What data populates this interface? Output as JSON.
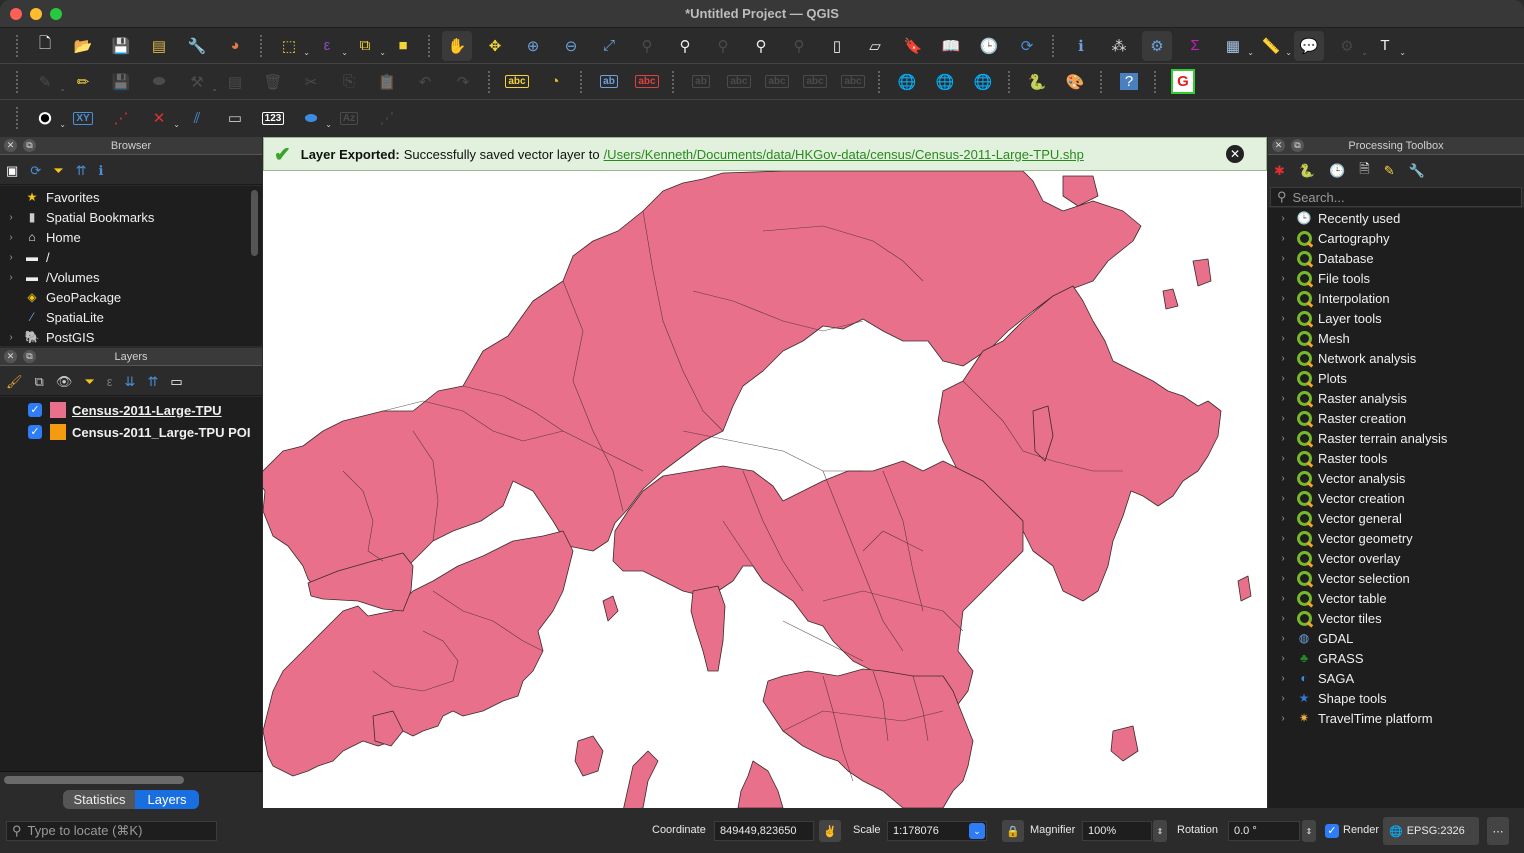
{
  "window": {
    "title": "*Untitled Project — QGIS"
  },
  "toolbar_rows": [
    [
      {
        "name": "new-project-icon",
        "glyph": "🗋",
        "color": "#fff"
      },
      {
        "name": "open-project-icon",
        "glyph": "📂",
        "color": "#f4c542"
      },
      {
        "name": "save-project-icon",
        "glyph": "💾",
        "color": "#5a8ec9"
      },
      {
        "name": "new-print-layout-icon",
        "glyph": "▤",
        "color": "#e2b84a"
      },
      {
        "name": "layout-manager-icon",
        "glyph": "🔧",
        "color": "#ddd"
      },
      {
        "name": "style-manager-icon",
        "glyph": "◕",
        "color": "#e07a4a"
      },
      {
        "sep": true
      },
      {
        "name": "select-features-icon",
        "glyph": "⬚",
        "color": "#f5d33a",
        "dd": true
      },
      {
        "name": "select-by-expression-icon",
        "glyph": "ε",
        "color": "#8a4fb7",
        "dd": true
      },
      {
        "name": "deselect-features-icon",
        "glyph": "⧉",
        "color": "#f5d33a",
        "dd": true
      },
      {
        "name": "select-by-location-icon",
        "glyph": "■",
        "color": "#f5d33a"
      },
      {
        "sep": true
      },
      {
        "name": "pan-map-icon",
        "glyph": "✋",
        "color": "#fff",
        "active": true
      },
      {
        "name": "pan-to-selection-icon",
        "glyph": "✥",
        "color": "#f5d33a"
      },
      {
        "name": "zoom-in-icon",
        "glyph": "⊕",
        "color": "#6ea2dc"
      },
      {
        "name": "zoom-out-icon",
        "glyph": "⊖",
        "color": "#6ea2dc"
      },
      {
        "name": "zoom-full-icon",
        "glyph": "⤢",
        "color": "#6ea2dc"
      },
      {
        "name": "zoom-to-selection-icon",
        "glyph": "⚲",
        "color": "#888",
        "dim": true
      },
      {
        "name": "zoom-to-layer-icon",
        "glyph": "⚲",
        "color": "#eee"
      },
      {
        "name": "zoom-native-icon",
        "glyph": "⚲",
        "color": "#888",
        "dim": true
      },
      {
        "name": "zoom-last-icon",
        "glyph": "⚲",
        "color": "#eee"
      },
      {
        "name": "zoom-next-icon",
        "glyph": "⚲",
        "color": "#888",
        "dim": true
      },
      {
        "name": "new-map-view-icon",
        "glyph": "▯",
        "color": "#eee"
      },
      {
        "name": "new-3d-map-view-icon",
        "glyph": "▱",
        "color": "#eee"
      },
      {
        "name": "new-spatial-bookmark-icon",
        "glyph": "🔖",
        "color": "#5a8ec9"
      },
      {
        "name": "show-bookmarks-icon",
        "glyph": "📖",
        "color": "#eee"
      },
      {
        "name": "temporal-controller-icon",
        "glyph": "🕒",
        "color": "#eee"
      },
      {
        "name": "refresh-icon",
        "glyph": "⟳",
        "color": "#4a90d9"
      },
      {
        "sep": true
      },
      {
        "name": "identify-features-icon",
        "glyph": "ℹ",
        "color": "#6ea2dc"
      },
      {
        "name": "open-field-calculator-icon",
        "glyph": "⁂",
        "color": "#ddd"
      },
      {
        "name": "processing-toolbox-icon",
        "glyph": "⚙",
        "color": "#6ea2dc",
        "active": true
      },
      {
        "name": "statistical-summary-icon",
        "glyph": "Σ",
        "color": "#c020c0"
      },
      {
        "name": "attribute-table-icon",
        "glyph": "▦",
        "color": "#a9c7ea",
        "dd": true
      },
      {
        "name": "measure-line-icon",
        "glyph": "📏",
        "color": "#ccc",
        "dd": true
      },
      {
        "name": "map-tips-icon",
        "glyph": "💬",
        "color": "#f8e58c",
        "active": true
      },
      {
        "name": "run-action-icon",
        "glyph": "⚙",
        "color": "#777",
        "dd": true,
        "dim": true
      },
      {
        "name": "text-annotation-icon",
        "glyph": "T",
        "color": "#eee",
        "dd": true
      }
    ],
    [
      {
        "name": "current-edits-icon",
        "glyph": "✎",
        "color": "#888",
        "dim": true,
        "dd": true
      },
      {
        "name": "toggle-editing-icon",
        "glyph": "✏",
        "color": "#f5d33a"
      },
      {
        "name": "save-layer-edits-icon",
        "glyph": "💾",
        "color": "#888",
        "dim": true
      },
      {
        "name": "add-polygon-feature-icon",
        "glyph": "⬬",
        "color": "#888",
        "dim": true
      },
      {
        "name": "vertex-tool-icon",
        "glyph": "⚒",
        "color": "#888",
        "dim": true,
        "dd": true
      },
      {
        "name": "modify-attributes-icon",
        "glyph": "▤",
        "color": "#888",
        "dim": true
      },
      {
        "name": "delete-selected-icon",
        "glyph": "🗑",
        "color": "#888",
        "dim": true
      },
      {
        "name": "cut-features-icon",
        "glyph": "✂",
        "color": "#888",
        "dim": true
      },
      {
        "name": "copy-features-icon",
        "glyph": "⎘",
        "color": "#888",
        "dim": true
      },
      {
        "name": "paste-features-icon",
        "glyph": "📋",
        "color": "#888",
        "dim": true
      },
      {
        "name": "undo-icon",
        "glyph": "↶",
        "color": "#888",
        "dim": true
      },
      {
        "name": "redo-icon",
        "glyph": "↷",
        "color": "#888",
        "dim": true
      },
      {
        "sep": true
      },
      {
        "name": "layer-labeling-options-icon",
        "glyph": "abc",
        "color": "#f5d33a",
        "small": true
      },
      {
        "name": "layer-diagram-options-icon",
        "glyph": "◔",
        "color": "#e8c020"
      },
      {
        "sep": true
      },
      {
        "name": "pin-labels-icon",
        "glyph": "ab",
        "color": "#6ea2dc",
        "small": true
      },
      {
        "name": "highlight-pinned-labels-icon",
        "glyph": "abc",
        "color": "#e04040",
        "small": true
      },
      {
        "sep": true
      },
      {
        "name": "move-label-icon",
        "glyph": "ab",
        "color": "#888",
        "dim": true,
        "small": true
      },
      {
        "name": "show-hide-labels-icon",
        "glyph": "abc",
        "color": "#888",
        "dim": true,
        "small": true
      },
      {
        "name": "move-label-arrow-icon",
        "glyph": "abc",
        "color": "#888",
        "dim": true,
        "small": true
      },
      {
        "name": "rotate-label-icon",
        "glyph": "abc",
        "color": "#888",
        "dim": true,
        "small": true
      },
      {
        "name": "change-label-icon",
        "glyph": "abc",
        "color": "#888",
        "dim": true,
        "small": true
      },
      {
        "sep": true
      },
      {
        "name": "add-wms-layer-icon",
        "glyph": "🌐",
        "color": "#4a90d9"
      },
      {
        "name": "search-metasearch-icon",
        "glyph": "🌐",
        "color": "#4a90d9"
      },
      {
        "name": "metasearch-icon",
        "glyph": "🌐",
        "color": "#aaa"
      },
      {
        "sep": true
      },
      {
        "name": "python-console-icon",
        "glyph": "🐍",
        "color": "#f5c518"
      },
      {
        "name": "style-palette-icon",
        "glyph": "🎨",
        "color": "#e8a840"
      },
      {
        "sep": true
      },
      {
        "name": "help-icon",
        "glyph": "?",
        "color": "#fff"
      },
      {
        "sep": true
      },
      {
        "name": "plugin-icon",
        "glyph": "G",
        "color": "#e02020"
      }
    ],
    [
      {
        "name": "digitize-shape-icon",
        "glyph": "●",
        "color": "#000",
        "dd": true
      },
      {
        "name": "add-xy-icon",
        "glyph": "XY",
        "color": "#4a90d9",
        "small": true
      },
      {
        "name": "add-vertex-icon",
        "glyph": "⋰",
        "color": "#e03030"
      },
      {
        "name": "delete-vertex-icon",
        "glyph": "✕",
        "color": "#e03030",
        "dd": true
      },
      {
        "name": "split-icon",
        "glyph": "⫽",
        "color": "#4a90d9"
      },
      {
        "name": "measure-bearing-icon",
        "glyph": "▭",
        "color": "#ccc"
      },
      {
        "name": "number-label-icon",
        "glyph": "123",
        "color": "#fff",
        "small": true
      },
      {
        "name": "shape-tools-icon",
        "glyph": "⬬",
        "color": "#3a8de0",
        "dd": true
      },
      {
        "name": "azimuth-tool-icon",
        "glyph": "Az",
        "color": "#888",
        "dim": true,
        "small": true
      },
      {
        "name": "line-tool-icon",
        "glyph": "⋰",
        "color": "#888",
        "dim": true
      }
    ]
  ],
  "browser": {
    "title": "Browser",
    "toolbar": [
      {
        "name": "add-selected-layers-icon",
        "glyph": "▣",
        "color": "#fff"
      },
      {
        "name": "refresh-browser-icon",
        "glyph": "⟳",
        "color": "#4a90d9"
      },
      {
        "name": "filter-browser-icon",
        "glyph": "⏷",
        "color": "#f5c518"
      },
      {
        "name": "collapse-all-icon",
        "glyph": "⇈",
        "color": "#4a90d9"
      },
      {
        "name": "properties-icon",
        "glyph": "ℹ",
        "color": "#4a90d9"
      }
    ],
    "items": [
      {
        "label": "Favorites",
        "icon": "star-icon",
        "glyph": "★",
        "color": "#f5c518",
        "expand": false
      },
      {
        "label": "Spatial Bookmarks",
        "icon": "bookmark-icon",
        "glyph": "▮",
        "color": "#ccc",
        "expand": true
      },
      {
        "label": "Home",
        "icon": "home-folder-icon",
        "glyph": "⌂",
        "color": "#eee",
        "expand": true
      },
      {
        "label": "/",
        "icon": "folder-icon",
        "glyph": "▬",
        "color": "#eee",
        "expand": true
      },
      {
        "label": "/Volumes",
        "icon": "folder-icon",
        "glyph": "▬",
        "color": "#eee",
        "expand": true
      },
      {
        "label": "GeoPackage",
        "icon": "geopackage-icon",
        "glyph": "◈",
        "color": "#f5c518",
        "expand": false
      },
      {
        "label": "SpatiaLite",
        "icon": "feather-icon",
        "glyph": "⁄",
        "color": "#6ea2dc",
        "expand": false
      },
      {
        "label": "PostGIS",
        "icon": "elephant-icon",
        "glyph": "🐘",
        "color": "#6ea2dc",
        "expand": true
      }
    ]
  },
  "layers": {
    "title": "Layers",
    "toolbar": [
      {
        "name": "style-layer-icon",
        "glyph": "🖌",
        "color": "#e0a040"
      },
      {
        "name": "add-group-icon",
        "glyph": "⧉",
        "color": "#ccc"
      },
      {
        "name": "visibility-icon",
        "glyph": "👁",
        "color": "#ccc"
      },
      {
        "name": "filter-legend-icon",
        "glyph": "⏷",
        "color": "#f5c518"
      },
      {
        "name": "expression-filter-icon",
        "glyph": "ε",
        "color": "#777"
      },
      {
        "name": "expand-all-icon",
        "glyph": "⇊",
        "color": "#4a90d9"
      },
      {
        "name": "collapse-all-icon",
        "glyph": "⇈",
        "color": "#4a90d9"
      },
      {
        "name": "remove-layer-icon",
        "glyph": "▭",
        "color": "#fff"
      }
    ],
    "items": [
      {
        "label": "Census-2011-Large-TPU",
        "color": "#e8708a",
        "checked": true,
        "underline": true
      },
      {
        "label": "Census-2011_Large-TPU POI",
        "color": "#f39c12",
        "checked": true,
        "underline": false
      }
    ]
  },
  "bottom_tabs": [
    {
      "label": "Statistics",
      "active": false
    },
    {
      "label": "Layers",
      "active": true
    }
  ],
  "message": {
    "title": "Layer Exported:",
    "text": "Successfully saved vector layer to",
    "link": "/Users/Kenneth/Documents/data/HKGov-data/census/Census-2011-Large-TPU.shp"
  },
  "map": {
    "fill": "#e8708a",
    "stroke": "#3a2a2a",
    "background": "#ffffff"
  },
  "processing": {
    "title": "Processing Toolbox",
    "search_placeholder": "Search...",
    "items": [
      {
        "label": "Recently used",
        "icon": "clock-icon"
      },
      {
        "label": "Cartography",
        "icon": "qgis-icon"
      },
      {
        "label": "Database",
        "icon": "qgis-icon"
      },
      {
        "label": "File tools",
        "icon": "qgis-icon"
      },
      {
        "label": "Interpolation",
        "icon": "qgis-icon"
      },
      {
        "label": "Layer tools",
        "icon": "qgis-icon"
      },
      {
        "label": "Mesh",
        "icon": "qgis-icon"
      },
      {
        "label": "Network analysis",
        "icon": "qgis-icon"
      },
      {
        "label": "Plots",
        "icon": "qgis-icon"
      },
      {
        "label": "Raster analysis",
        "icon": "qgis-icon"
      },
      {
        "label": "Raster creation",
        "icon": "qgis-icon"
      },
      {
        "label": "Raster terrain analysis",
        "icon": "qgis-icon"
      },
      {
        "label": "Raster tools",
        "icon": "qgis-icon"
      },
      {
        "label": "Vector analysis",
        "icon": "qgis-icon"
      },
      {
        "label": "Vector creation",
        "icon": "qgis-icon"
      },
      {
        "label": "Vector general",
        "icon": "qgis-icon"
      },
      {
        "label": "Vector geometry",
        "icon": "qgis-icon"
      },
      {
        "label": "Vector overlay",
        "icon": "qgis-icon"
      },
      {
        "label": "Vector selection",
        "icon": "qgis-icon"
      },
      {
        "label": "Vector table",
        "icon": "qgis-icon"
      },
      {
        "label": "Vector tiles",
        "icon": "qgis-icon"
      },
      {
        "label": "GDAL",
        "icon": "gdal-icon"
      },
      {
        "label": "GRASS",
        "icon": "grass-icon"
      },
      {
        "label": "SAGA",
        "icon": "saga-icon"
      },
      {
        "label": "Shape tools",
        "icon": "star-icon"
      },
      {
        "label": "TravelTime platform",
        "icon": "traveltime-icon"
      }
    ]
  },
  "statusbar": {
    "locate_placeholder": "Type to locate (⌘K)",
    "coordinate_label": "Coordinate",
    "coordinate_value": "849449,823650",
    "scale_label": "Scale",
    "scale_value": "1:178076",
    "magnifier_label": "Magnifier",
    "magnifier_value": "100%",
    "rotation_label": "Rotation",
    "rotation_value": "0.0 °",
    "render_label": "Render",
    "render_checked": true,
    "crs": "EPSG:2326"
  }
}
